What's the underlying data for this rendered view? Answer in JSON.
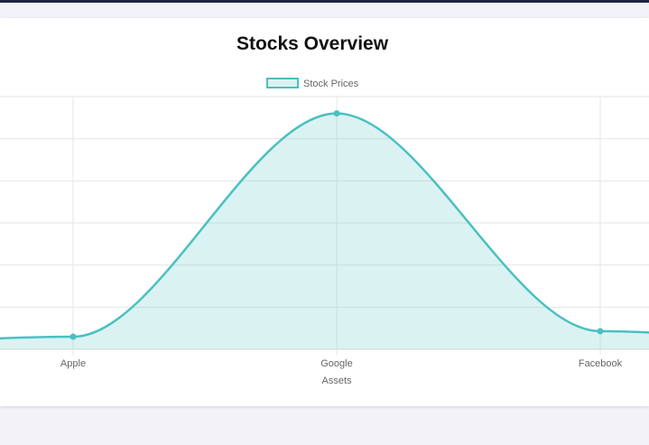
{
  "chart_data": {
    "type": "area",
    "title": "Stocks Overview",
    "xlabel": "Assets",
    "ylabel": "",
    "categories": [
      "Apple",
      "Google",
      "Facebook"
    ],
    "series": [
      {
        "name": "Stock Prices",
        "values": [
          3,
          56,
          4.3
        ],
        "color": "#4bc0c0"
      }
    ],
    "ylim": [
      0,
      60
    ],
    "grid": true,
    "legend": "top-center"
  }
}
